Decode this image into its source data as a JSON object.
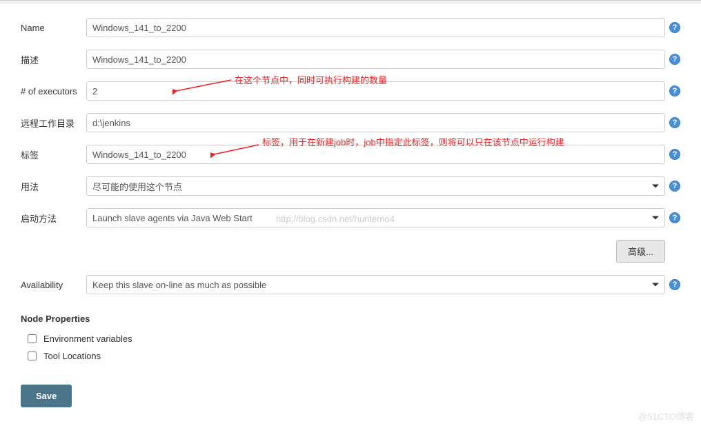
{
  "fields": {
    "name": {
      "label": "Name",
      "value": "Windows_141_to_2200"
    },
    "description": {
      "label": "描述",
      "value": "Windows_141_to_2200"
    },
    "executors": {
      "label": "# of executors",
      "value": "2"
    },
    "remote_root": {
      "label": "远程工作目录",
      "value": "d:\\jenkins"
    },
    "labels": {
      "label": "标签",
      "value": "Windows_141_to_2200"
    },
    "usage": {
      "label": "用法",
      "value": "尽可能的使用这个节点"
    },
    "launch": {
      "label": "启动方法",
      "value": "Launch slave agents via Java Web Start"
    },
    "availability": {
      "label": "Availability",
      "value": "Keep this slave on-line as much as possible"
    }
  },
  "advanced_button": "高级...",
  "node_properties": {
    "header": "Node Properties",
    "env_vars": "Environment variables",
    "tool_locations": "Tool Locations"
  },
  "save_button": "Save",
  "annotations": {
    "executors": "在这个节点中，同时可执行构建的数量",
    "labels": "标签，用于在新建job时，job中指定此标签，则将可以只在该节点中运行构建"
  },
  "watermark": "@51CTO博客",
  "faint_url": "http://blog.csdn.net/hunterno4"
}
